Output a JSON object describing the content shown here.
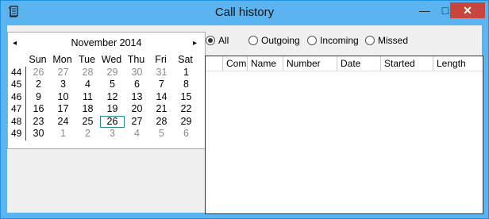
{
  "window": {
    "title": "Call history",
    "minimize_glyph": "—",
    "maximize_glyph": "□",
    "close_glyph": "✕",
    "app_icon": "call-history-app-icon"
  },
  "calendar": {
    "month_label": "November 2014",
    "prev_glyph": "◂",
    "next_glyph": "▸",
    "weekday_headers": [
      "Sun",
      "Mon",
      "Tue",
      "Wed",
      "Thu",
      "Fri",
      "Sat"
    ],
    "weeks": [
      {
        "week": "44",
        "days": [
          "26",
          "27",
          "28",
          "29",
          "30",
          "31",
          "1"
        ]
      },
      {
        "week": "45",
        "days": [
          "2",
          "3",
          "4",
          "5",
          "6",
          "7",
          "8"
        ]
      },
      {
        "week": "46",
        "days": [
          "9",
          "10",
          "11",
          "12",
          "13",
          "14",
          "15"
        ]
      },
      {
        "week": "47",
        "days": [
          "16",
          "17",
          "18",
          "19",
          "20",
          "21",
          "22"
        ]
      },
      {
        "week": "48",
        "days": [
          "23",
          "24",
          "25",
          "26",
          "27",
          "28",
          "29"
        ]
      },
      {
        "week": "49",
        "days": [
          "30",
          "1",
          "2",
          "3",
          "4",
          "5",
          "6"
        ]
      }
    ],
    "selected_day": "26"
  },
  "filters": {
    "options": [
      "All",
      "Outgoing",
      "Incoming",
      "Missed"
    ],
    "selected": "All"
  },
  "table": {
    "columns": [
      "",
      "Com",
      "Name",
      "Number",
      "Date",
      "Started",
      "Length"
    ],
    "rows": []
  },
  "colors": {
    "titlebar": "#5bb4f0",
    "close": "#c7463d",
    "today_outline": "#2b8a8a"
  }
}
